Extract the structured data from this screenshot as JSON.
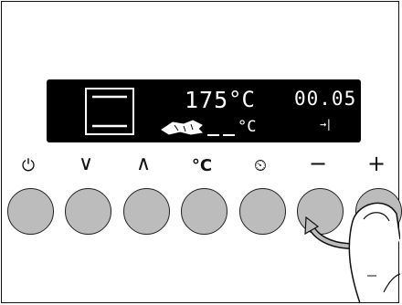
{
  "display": {
    "mode_icon": "conventional-heating-icon",
    "temperature": "175",
    "temperature_unit": "°C",
    "time": "00.05",
    "timer_end_icon": "arrow-to-bar-icon",
    "timer_end_glyph": "→|",
    "probe_unit": "°C"
  },
  "controls": [
    {
      "label": "⏻",
      "icon": "power-icon"
    },
    {
      "label": "∨",
      "icon": "chevron-down-icon"
    },
    {
      "label": "∧",
      "icon": "chevron-up-icon"
    },
    {
      "label": "°C",
      "icon": "temperature-icon"
    },
    {
      "label": "⏲",
      "icon": "timer-icon"
    },
    {
      "label": "−",
      "icon": "minus-icon"
    },
    {
      "label": "+",
      "icon": "plus-icon"
    }
  ],
  "colors": {
    "display_bg": "#000000",
    "display_fg": "#ffffff",
    "button_fill": "#bcbcbc",
    "line": "#111111"
  }
}
